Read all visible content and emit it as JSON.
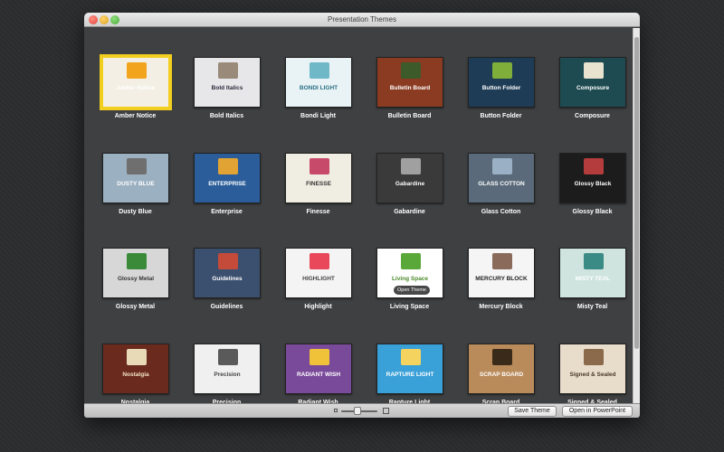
{
  "window": {
    "title": "Presentation Themes"
  },
  "themes": [
    {
      "name": "Amber Notice",
      "thumb_title": "Amber Notice",
      "bg": "#f3efe4",
      "accent": "#f2a51c",
      "fg": "#ffffff",
      "selected": true,
      "hover_label": ""
    },
    {
      "name": "Bold Italics",
      "thumb_title": "Bold Italics",
      "bg": "#e7e7ea",
      "accent": "#9a8a7a",
      "fg": "#2a2a3a",
      "selected": false,
      "hover_label": ""
    },
    {
      "name": "Bondi Light",
      "thumb_title": "BONDI LIGHT",
      "bg": "#e9f3f5",
      "accent": "#6fb8c7",
      "fg": "#2a6f84",
      "selected": false,
      "hover_label": ""
    },
    {
      "name": "Bulletin Board",
      "thumb_title": "Bulletin Board",
      "bg": "#8a3b22",
      "accent": "#3c5a2a",
      "fg": "#ffffff",
      "selected": false,
      "hover_label": ""
    },
    {
      "name": "Button Folder",
      "thumb_title": "Button Folder",
      "bg": "#1f3c56",
      "accent": "#7fae3a",
      "fg": "#ffffff",
      "selected": false,
      "hover_label": ""
    },
    {
      "name": "Composure",
      "thumb_title": "Composure",
      "bg": "#1e4b52",
      "accent": "#e9e2cf",
      "fg": "#ffffff",
      "selected": false,
      "hover_label": ""
    },
    {
      "name": "Dusty Blue",
      "thumb_title": "DUSTY BLUE",
      "bg": "#9bb0c1",
      "accent": "#6f6f6f",
      "fg": "#ffffff",
      "selected": false,
      "hover_label": ""
    },
    {
      "name": "Enterprise",
      "thumb_title": "ENTERPRISE",
      "bg": "#2a5d9a",
      "accent": "#e2a335",
      "fg": "#ffffff",
      "selected": false,
      "hover_label": ""
    },
    {
      "name": "Finesse",
      "thumb_title": "FINESSE",
      "bg": "#f0ede2",
      "accent": "#c84a6b",
      "fg": "#333333",
      "selected": false,
      "hover_label": ""
    },
    {
      "name": "Gabardine",
      "thumb_title": "Gabardine",
      "bg": "#3a3a3a",
      "accent": "#a0a0a0",
      "fg": "#ffffff",
      "selected": false,
      "hover_label": ""
    },
    {
      "name": "Glass Cotton",
      "thumb_title": "GLASS COTTON",
      "bg": "#5a6a7a",
      "accent": "#9ab0c4",
      "fg": "#ffffff",
      "selected": false,
      "hover_label": ""
    },
    {
      "name": "Glossy Black",
      "thumb_title": "Glossy Black",
      "bg": "#1c1c1c",
      "accent": "#b53c3c",
      "fg": "#ffffff",
      "selected": false,
      "hover_label": ""
    },
    {
      "name": "Glossy Metal",
      "thumb_title": "Glossy Metal",
      "bg": "#d7d7d7",
      "accent": "#3b8a3a",
      "fg": "#333333",
      "selected": false,
      "hover_label": ""
    },
    {
      "name": "Guidelines",
      "thumb_title": "Guidelines",
      "bg": "#3b4f6f",
      "accent": "#c44a3a",
      "fg": "#ffffff",
      "selected": false,
      "hover_label": ""
    },
    {
      "name": "Highlight",
      "thumb_title": "HIGHLIGHT",
      "bg": "#f4f4f4",
      "accent": "#e8485a",
      "fg": "#444444",
      "selected": false,
      "hover_label": ""
    },
    {
      "name": "Living Space",
      "thumb_title": "Living Space",
      "bg": "#ffffff",
      "accent": "#5aa83a",
      "fg": "#4a8a2a",
      "selected": false,
      "hover_label": "Open Theme"
    },
    {
      "name": "Mercury Block",
      "thumb_title": "MERCURY BLOCK",
      "bg": "#f5f5f5",
      "accent": "#8a6a5a",
      "fg": "#222222",
      "selected": false,
      "hover_label": ""
    },
    {
      "name": "Misty Teal",
      "thumb_title": "MISTY TEAL",
      "bg": "#cfe4df",
      "accent": "#3a8a85",
      "fg": "#ffffff",
      "selected": false,
      "hover_label": ""
    },
    {
      "name": "Nostalgia",
      "thumb_title": "Nostalgia",
      "bg": "#6a2a1e",
      "accent": "#e8d9b7",
      "fg": "#f1e3c2",
      "selected": false,
      "hover_label": ""
    },
    {
      "name": "Precision",
      "thumb_title": "Precision",
      "bg": "#f0f0f0",
      "accent": "#5a5a5a",
      "fg": "#444444",
      "selected": false,
      "hover_label": ""
    },
    {
      "name": "Radiant Wish",
      "thumb_title": "RADIANT WISH",
      "bg": "#7a4a9a",
      "accent": "#f0c23a",
      "fg": "#ffffff",
      "selected": false,
      "hover_label": ""
    },
    {
      "name": "Rapture Light",
      "thumb_title": "RAPTURE LIGHT",
      "bg": "#3aa0d8",
      "accent": "#f4d35e",
      "fg": "#ffffff",
      "selected": false,
      "hover_label": ""
    },
    {
      "name": "Scrap Board",
      "thumb_title": "SCRAP BOARD",
      "bg": "#b98a5a",
      "accent": "#3a2a1a",
      "fg": "#ffffff",
      "selected": false,
      "hover_label": ""
    },
    {
      "name": "Signed & Sealed",
      "thumb_title": "Signed & Sealed",
      "bg": "#e8ddcb",
      "accent": "#8a6a4a",
      "fg": "#4a3a2a",
      "selected": false,
      "hover_label": ""
    }
  ],
  "bottombar": {
    "zoom_level": 0.45,
    "save_theme_label": "Save Theme",
    "open_label": "Open in PowerPoint"
  }
}
